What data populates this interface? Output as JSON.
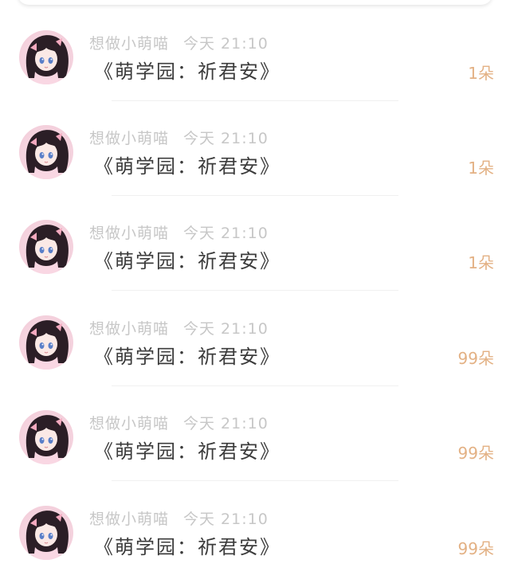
{
  "gift_list": {
    "items": [
      {
        "user_name": "想做小萌喵",
        "time": "今天 21:10",
        "message": "《萌学园：祈君安》",
        "count": "1朵"
      },
      {
        "user_name": "想做小萌喵",
        "time": "今天 21:10",
        "message": "《萌学园：祈君安》",
        "count": "1朵"
      },
      {
        "user_name": "想做小萌喵",
        "time": "今天 21:10",
        "message": "《萌学园：祈君安》",
        "count": "1朵"
      },
      {
        "user_name": "想做小萌喵",
        "time": "今天 21:10",
        "message": "《萌学园：祈君安》",
        "count": "99朵"
      },
      {
        "user_name": "想做小萌喵",
        "time": "今天 21:10",
        "message": "《萌学园：祈君安》",
        "count": "99朵"
      },
      {
        "user_name": "想做小萌喵",
        "time": "今天 21:10",
        "message": "《萌学园：祈君安》",
        "count": "99朵"
      }
    ]
  },
  "colors": {
    "meta_text": "#c7c7c7",
    "message_text": "#3c3c3c",
    "count_text": "#e3b184",
    "avatar_bg": "#f6d5e0"
  }
}
